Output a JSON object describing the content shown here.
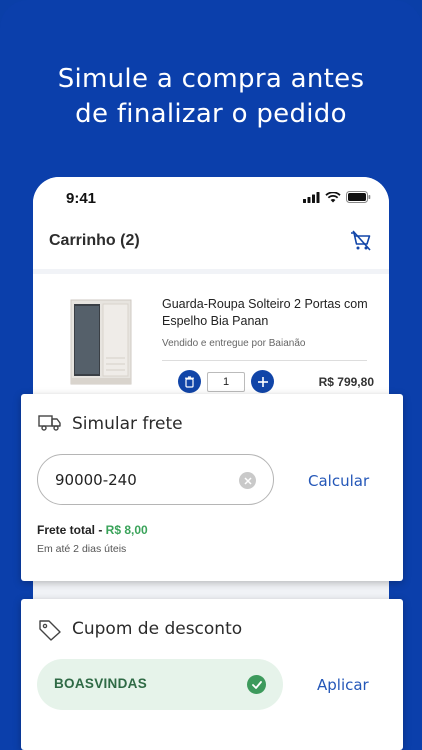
{
  "promo": {
    "headline_line1": "Simule a compra antes",
    "headline_line2": "de finalizar o pedido"
  },
  "status_bar": {
    "time": "9:41"
  },
  "cart": {
    "title": "Carrinho (2)",
    "product": {
      "name": "Guarda-Roupa Solteiro 2 Portas com Espelho Bia Panan",
      "seller": "Vendido e entregue por Baianão",
      "quantity": "1",
      "price": "R$ 799,80"
    }
  },
  "frete": {
    "title": "Simular frete",
    "cep_value": "90000-240",
    "calculate_label": "Calcular",
    "total_label": "Frete total - ",
    "total_value": "R$ 8,00",
    "delivery_time": "Em até 2 dias úteis"
  },
  "cupom": {
    "title": "Cupom de desconto",
    "code": "BOASVINDAS",
    "apply_label": "Aplicar"
  },
  "colors": {
    "background": "#0b3fab",
    "primary_button": "#1145a8",
    "link": "#2457b8",
    "success": "#3d9a5c",
    "coupon_bg": "#e6f3ea"
  },
  "icons": {
    "truck": "truck-icon",
    "tag": "tag-icon",
    "cart_clear": "cart-remove-icon",
    "trash": "trash-icon",
    "plus": "plus-icon",
    "clear": "clear-icon",
    "check": "check-icon"
  }
}
